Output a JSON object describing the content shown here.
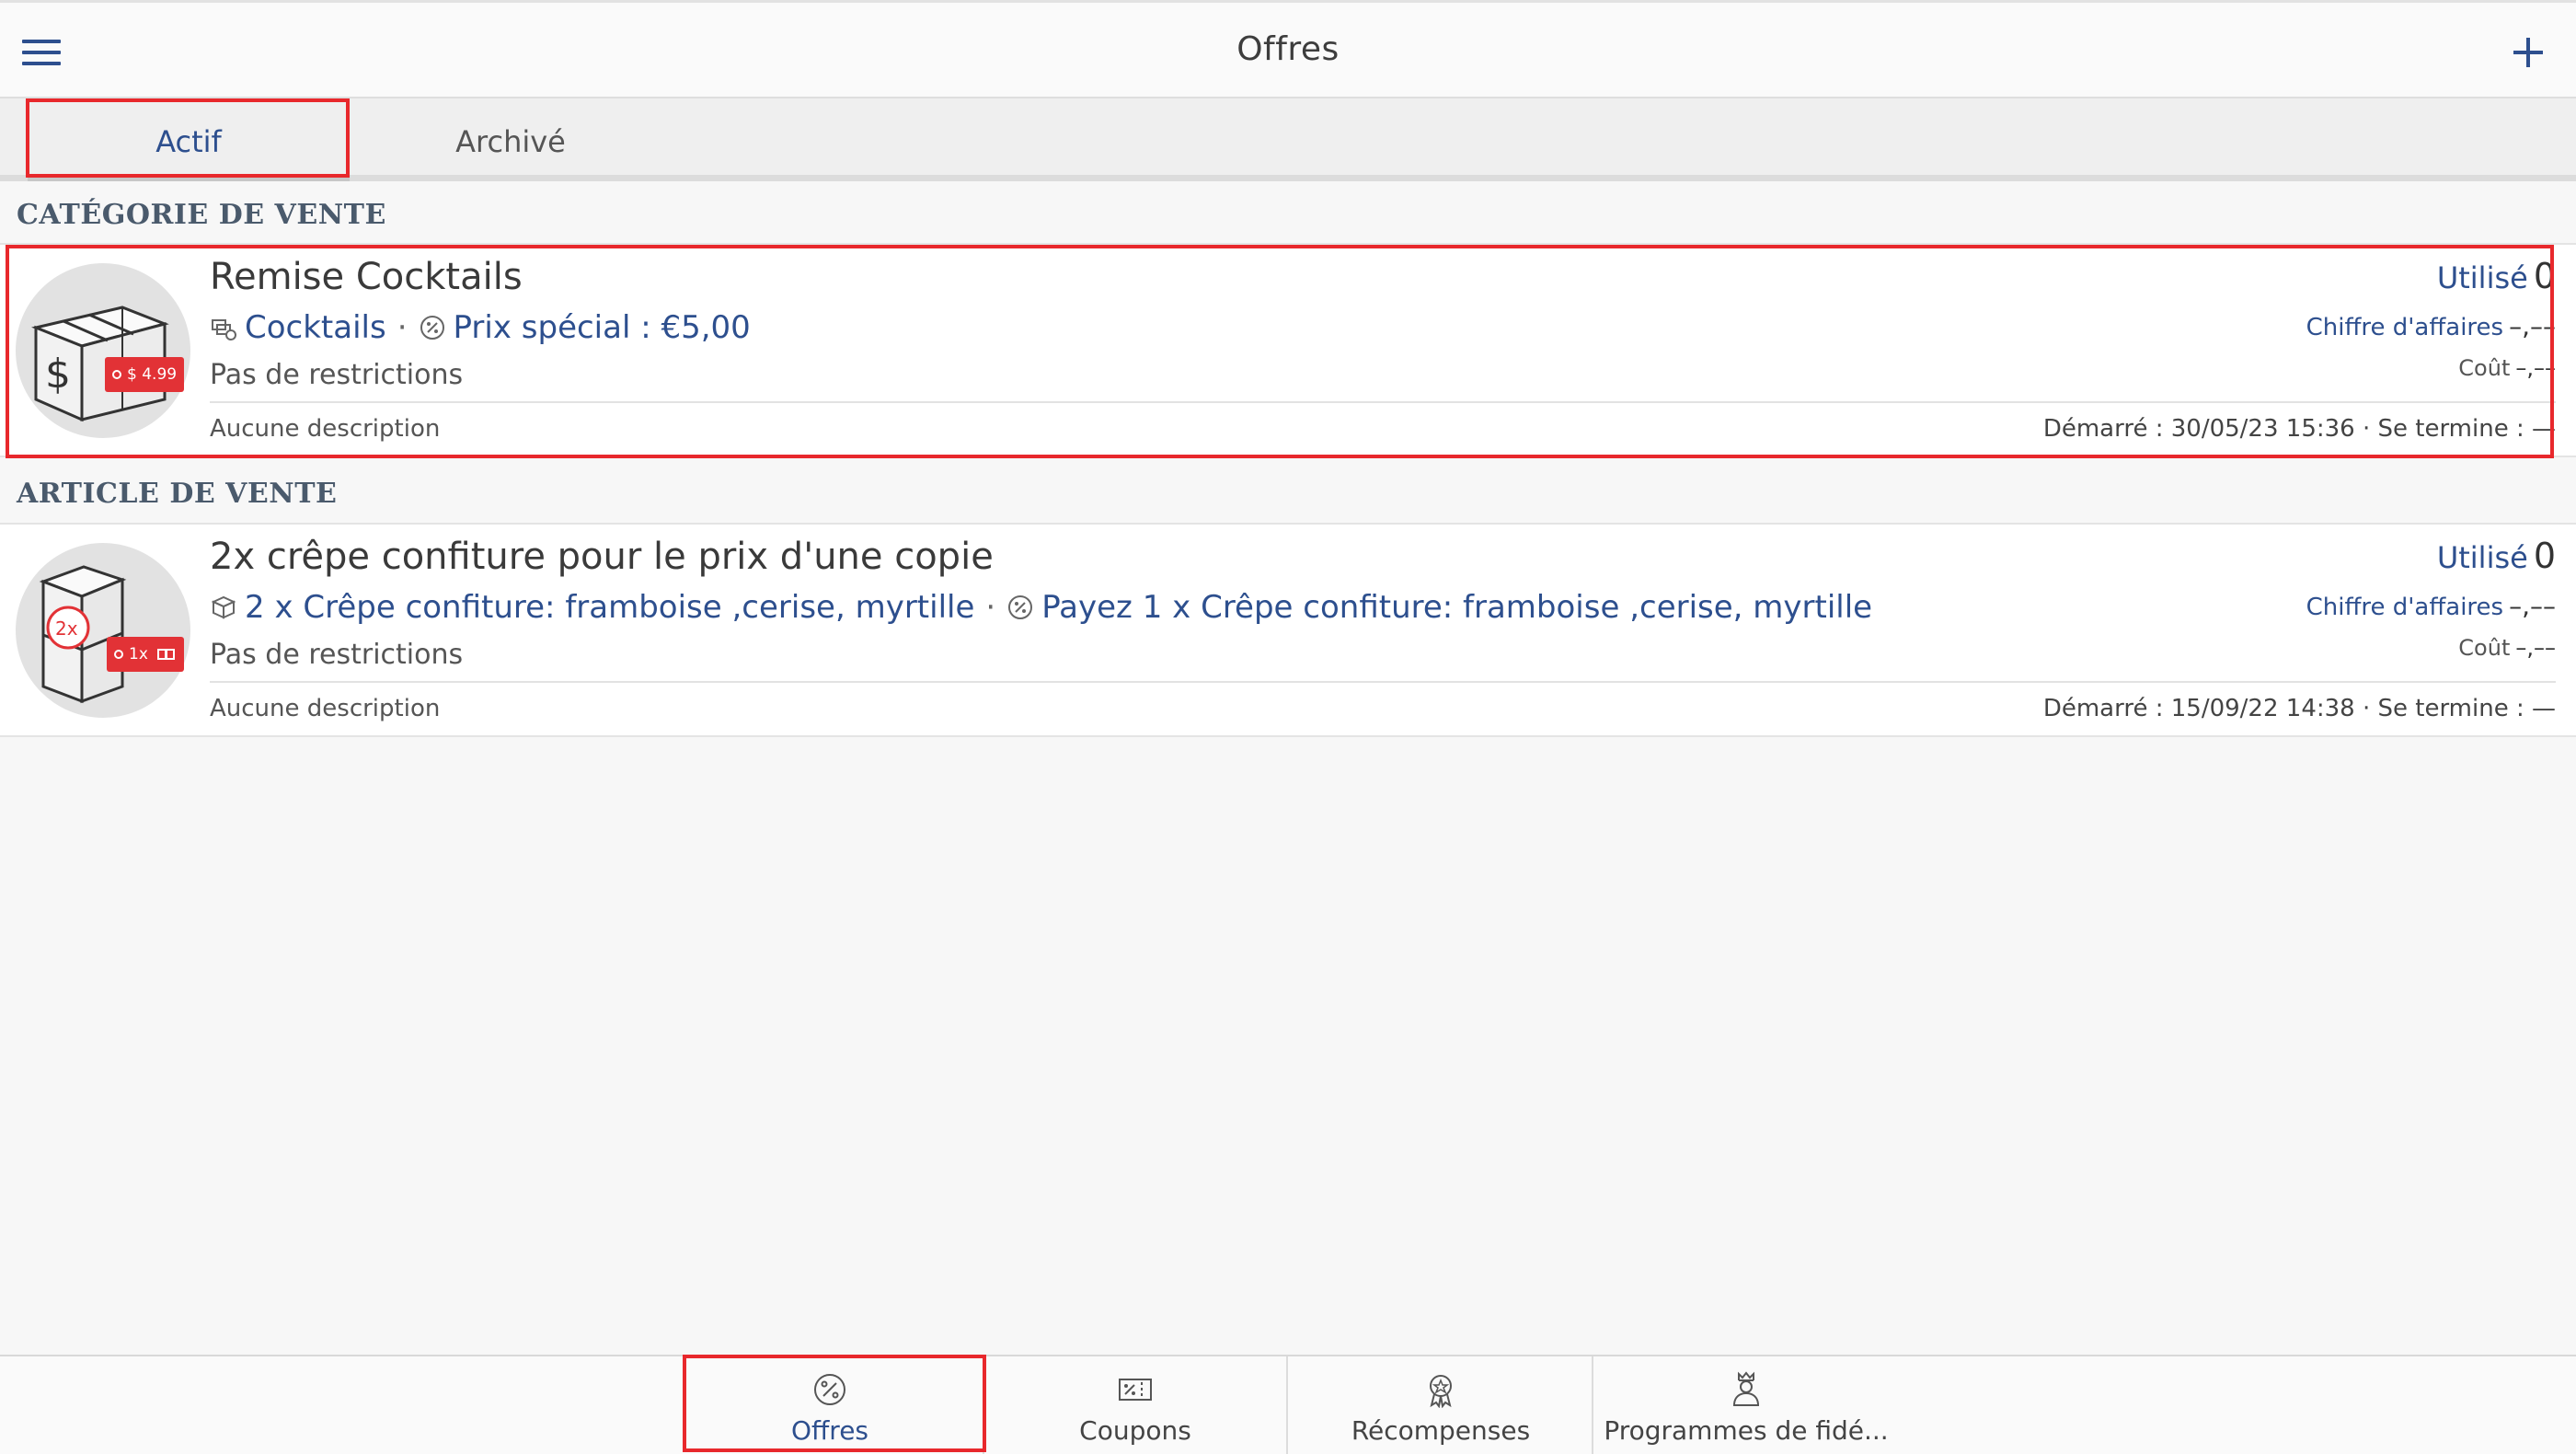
{
  "header": {
    "title": "Offres",
    "menu_icon": "hamburger-menu-icon",
    "add_icon": "plus-icon"
  },
  "tabs": [
    {
      "label": "Actif",
      "active": true
    },
    {
      "label": "Archivé",
      "active": false
    }
  ],
  "sections": [
    {
      "header": "CATÉGORIE DE VENTE",
      "offers": [
        {
          "title": "Remise Cocktails",
          "item": "Cocktails",
          "deal": "Prix spécial : €5,00",
          "restrictions": "Pas de restrictions",
          "description": "Aucune description",
          "used_label": "Utilisé",
          "used_value": "0",
          "revenue_label": "Chiffre d'affaires",
          "revenue_value": "–,––",
          "cost_label": "Coût",
          "cost_value": "–,––",
          "dates": "Démarré : 30/05/23 15:36 · Se termine : —",
          "tag": "$ 4.99"
        }
      ]
    },
    {
      "header": "ARTICLE DE VENTE",
      "offers": [
        {
          "title": "2x crêpe confiture pour le prix d'une copie",
          "item": "2 x Crêpe confiture: framboise ,cerise, myrtille",
          "deal": "Payez 1 x Crêpe confiture: framboise ,cerise, myrtille",
          "restrictions": "Pas de restrictions",
          "description": "Aucune description",
          "used_label": "Utilisé",
          "used_value": "0",
          "revenue_label": "Chiffre d'affaires",
          "revenue_value": "–,––",
          "cost_label": "Coût",
          "cost_value": "–,––",
          "dates": "Démarré : 15/09/22 14:38 · Se termine : —",
          "tag": "1x",
          "badge": "2x"
        }
      ]
    }
  ],
  "bottom_nav": [
    {
      "label": "Offres",
      "icon": "percent-badge-icon",
      "active": true
    },
    {
      "label": "Coupons",
      "icon": "coupon-icon",
      "active": false
    },
    {
      "label": "Récompenses",
      "icon": "award-icon",
      "active": false
    },
    {
      "label": "Programmes de fidé...",
      "icon": "loyalty-crown-icon",
      "active": false
    }
  ],
  "colors": {
    "accent": "#2d4f8e",
    "highlight": "#e8282c",
    "tag": "#e23236"
  }
}
